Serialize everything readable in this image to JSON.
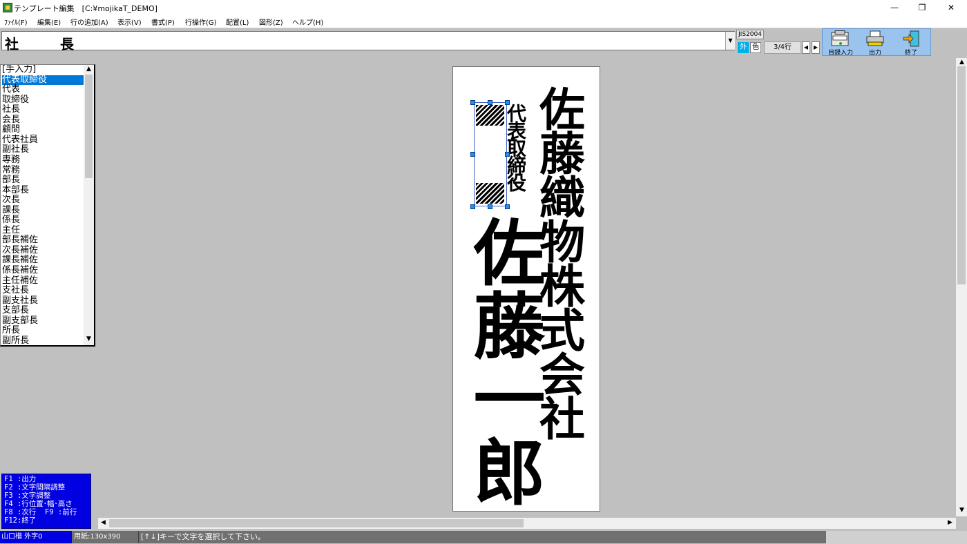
{
  "window": {
    "title": "テンプレート編集　[C:¥mojikaT_DEMO]",
    "minimize_glyph": "—",
    "restore_glyph": "❐",
    "close_glyph": "✕"
  },
  "menu": [
    "ﾌｧｲﾙ(F)",
    "編集(E)",
    "行の追加(A)",
    "表示(V)",
    "書式(P)",
    "行操作(G)",
    "配置(L)",
    "図形(Z)",
    "ヘルプ(H)"
  ],
  "line_input": {
    "value": "社　　　長"
  },
  "toolbar": {
    "charset": "JIS2004",
    "gaiji_label": "外",
    "color_label": "色",
    "line_indicator": "3/4行",
    "prev_glyph": "◀",
    "next_glyph": "▶",
    "tools": [
      {
        "label": "目録入力",
        "icon": "catalog-input-icon"
      },
      {
        "label": "出力",
        "icon": "printer-icon"
      },
      {
        "label": "終了",
        "icon": "exit-door-icon"
      }
    ]
  },
  "title_list": {
    "items": [
      "[手入力]",
      "代表取締役",
      "代表",
      "取締役",
      "社長",
      "会長",
      "顧問",
      "代表社員",
      "副社長",
      "専務",
      "常務",
      "部長",
      "本部長",
      "次長",
      "課長",
      "係長",
      "主任",
      "部長補佐",
      "次長補佐",
      "課長補佐",
      "係長補佐",
      "主任補佐",
      "支社長",
      "副支社長",
      "支部長",
      "副支部長",
      "所長",
      "副所長"
    ],
    "selected_index": 1
  },
  "preview": {
    "company": "佐藤織物株式会社",
    "title_text": "代表取締役",
    "person": "佐藤一郎"
  },
  "help_keys": [
    "F1 :出力",
    "F2 :文字間隔調整",
    "F3 :文字調整",
    "F4 :行位置･幅･高さ",
    "F8 :次行  F9 :前行",
    "F12:終了"
  ],
  "status": {
    "font_info": "山口楷 外字0",
    "paper": "用紙:130x390",
    "message": "[↑↓]キーで文字を選択して下さい。"
  }
}
